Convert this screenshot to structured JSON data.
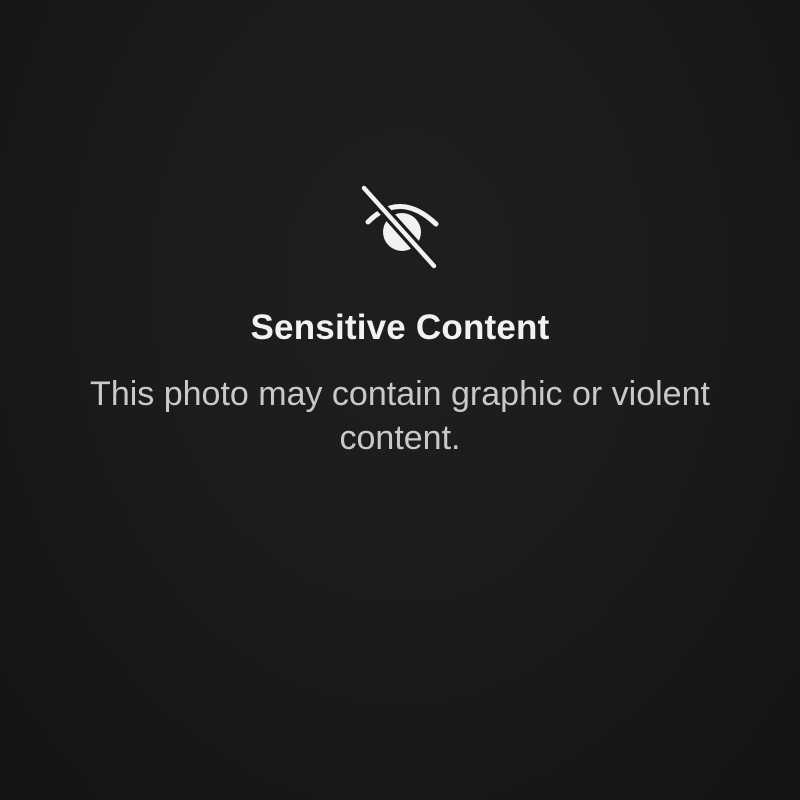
{
  "overlay": {
    "icon": "eye-slash-icon",
    "title": "Sensitive Content",
    "message": "This photo may contain graphic or violent content."
  },
  "colors": {
    "background": "#1b1c1c",
    "title_text": "#f2f2f2",
    "message_text": "#c9c9c9",
    "icon": "#f2f2f2"
  }
}
